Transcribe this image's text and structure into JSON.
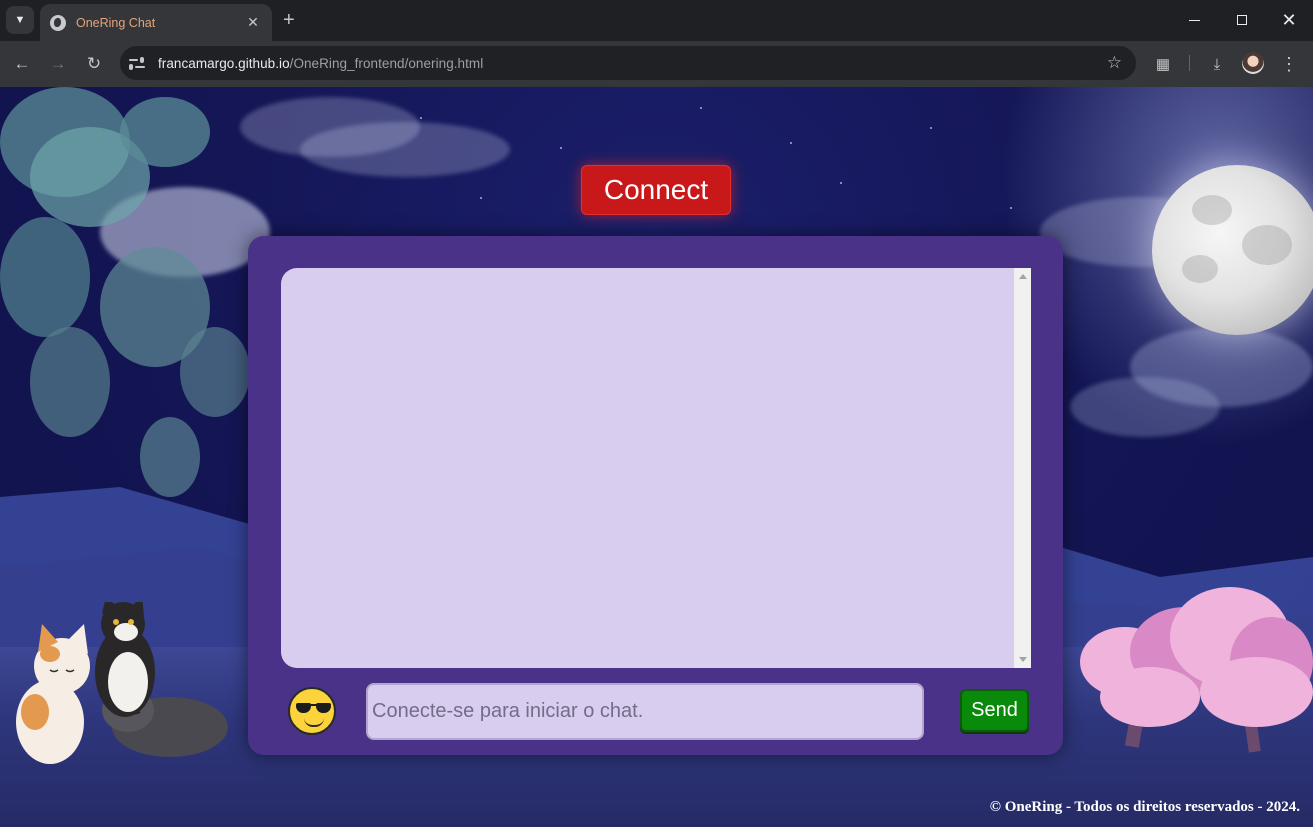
{
  "browser": {
    "tab_title": "OneRing Chat",
    "url_host": "francamargo.github.io",
    "url_path": "/OneRing_frontend/onering.html"
  },
  "page": {
    "connect_label": "Connect",
    "input_placeholder": "Conecte-se para iniciar o chat.",
    "emoji": "😎",
    "send_label": "Send",
    "footer": "© OneRing - Todos os direitos reservados - 2024."
  },
  "colors": {
    "connect_button": "#c8181a",
    "chat_panel": "#4a3288",
    "chat_box": "#d8cdee",
    "send_button": "#0a8a0a",
    "tab_title": "#e3a47d"
  },
  "icons": [
    "tab-search-icon",
    "globe-icon",
    "close-icon",
    "plus-icon",
    "minimize-icon",
    "maximize-icon",
    "window-close-icon",
    "back-icon",
    "forward-icon",
    "reload-icon",
    "site-info-icon",
    "star-icon",
    "extensions-icon",
    "download-icon",
    "profile-avatar",
    "menu-icon"
  ]
}
